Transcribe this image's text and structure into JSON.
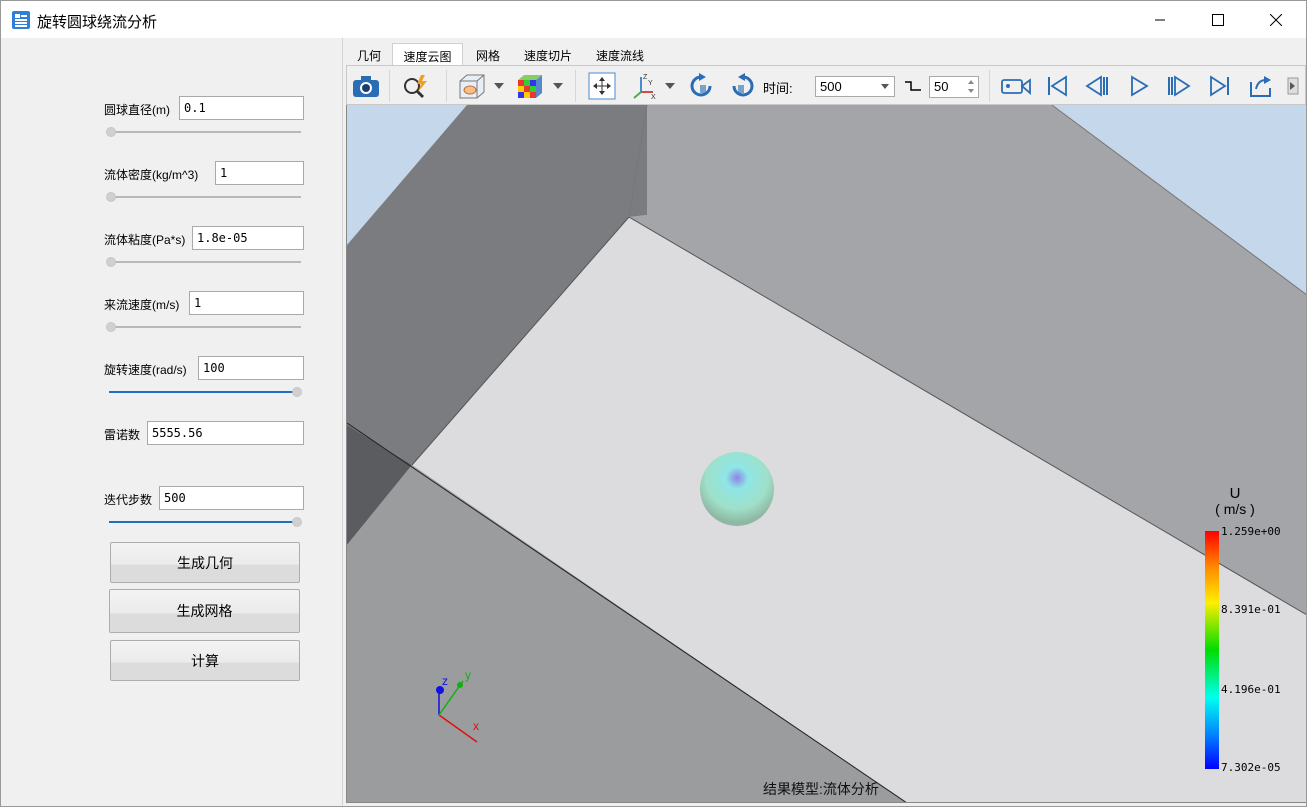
{
  "window": {
    "title": "旋转圆球绕流分析"
  },
  "params": [
    {
      "label": "圆球直径(m)",
      "value": "0.1"
    },
    {
      "label": "流体密度(kg/m^3)",
      "value": "1"
    },
    {
      "label": "流体粘度(Pa*s)",
      "value": "1.8e-05"
    },
    {
      "label": "来流速度(m/s)",
      "value": "1"
    },
    {
      "label": "旋转速度(rad/s)",
      "value": "100"
    },
    {
      "label": "雷诺数",
      "value": "5555.56"
    },
    {
      "label": "迭代步数",
      "value": "500"
    }
  ],
  "sliders": {
    "rotation_level": 1.0,
    "iteration_level": 1.0
  },
  "buttons": {
    "gen_geometry": "生成几何",
    "gen_mesh": "生成网格",
    "compute": "计算"
  },
  "tabs": [
    "几何",
    "速度云图",
    "网格",
    "速度切片",
    "速度流线"
  ],
  "active_tab": "速度云图",
  "toolbar": {
    "time_label": "时间:",
    "time_value": "500",
    "step_value": "50"
  },
  "legend": {
    "title": "U",
    "unit": "( m/s )",
    "ticks": [
      "1.259e+00",
      "8.391e-01",
      "4.196e-01",
      "7.302e-05"
    ]
  },
  "viewport": {
    "model_label": "结果模型:流体分析",
    "axes": {
      "x": "x",
      "y": "y",
      "z": "z"
    }
  },
  "colors": {
    "accent": "#1e6fbf",
    "sky": "#c5d7ea"
  },
  "icons": [
    "screenshot-icon",
    "zoom-fit-icon",
    "box-display-icon",
    "cube-color-icon",
    "pan-icon",
    "axes-orient-icon",
    "rotate-cw-icon",
    "rotate-ccw-icon",
    "record-icon",
    "first-frame-icon",
    "prev-frame-icon",
    "play-icon",
    "next-frame-icon",
    "last-frame-icon",
    "export-icon"
  ]
}
